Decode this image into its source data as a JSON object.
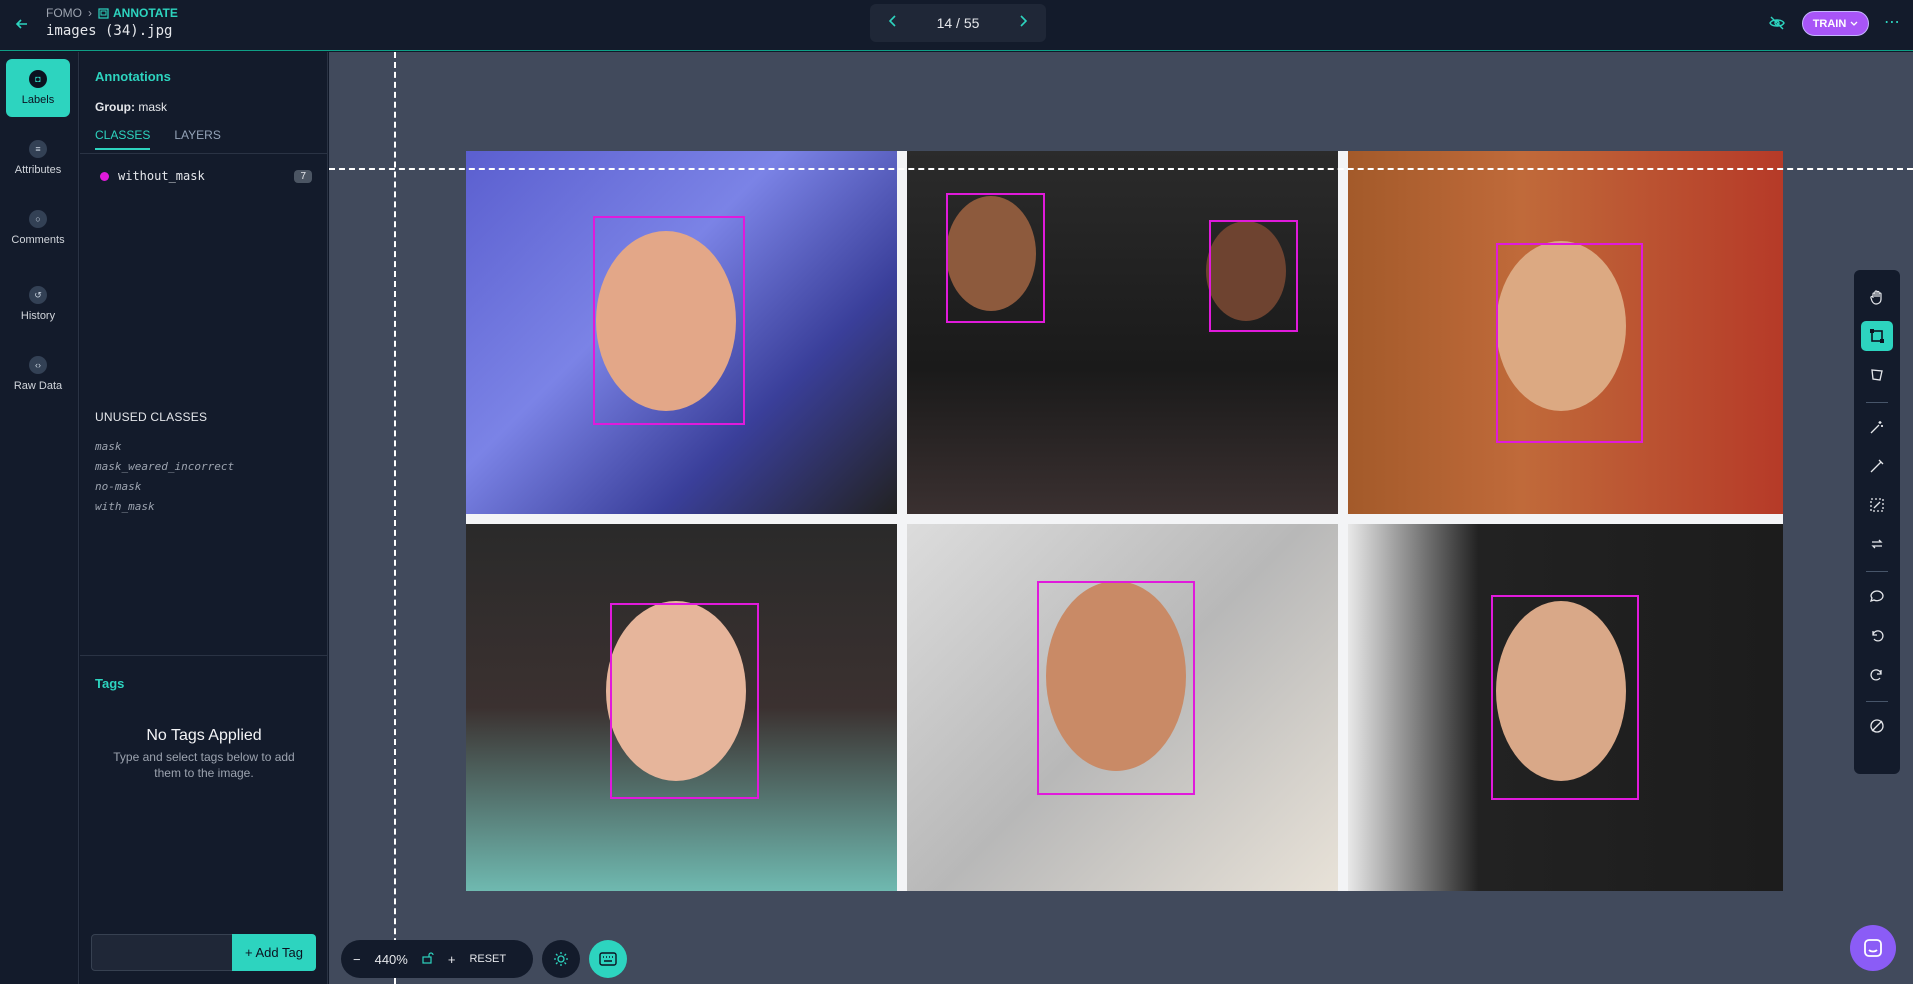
{
  "header": {
    "breadcrumb_root": "FOMO",
    "breadcrumb_current": "ANNOTATE",
    "filename": "images (34).jpg",
    "pager": "14 / 55",
    "train_label": "TRAIN"
  },
  "nav": {
    "items": [
      {
        "label": "Labels",
        "icon": "tag-icon"
      },
      {
        "label": "Attributes",
        "icon": "list-icon"
      },
      {
        "label": "Comments",
        "icon": "comment-icon"
      },
      {
        "label": "History",
        "icon": "history-icon"
      },
      {
        "label": "Raw Data",
        "icon": "code-icon"
      }
    ]
  },
  "panel": {
    "title": "Annotations",
    "group_label": "Group:",
    "group_value": "mask",
    "tabs": [
      "CLASSES",
      "LAYERS"
    ],
    "classes": [
      {
        "name": "without_mask",
        "count": "7",
        "color": "#e01adb"
      }
    ],
    "unused_title": "UNUSED CLASSES",
    "unused": [
      "mask",
      "mask_weared_incorrect",
      "no-mask",
      "with_mask"
    ],
    "tags_title": "Tags",
    "no_tags_title": "No Tags Applied",
    "no_tags_sub": "Type and select tags below to add them to the image.",
    "add_tag_label": "+ Add Tag"
  },
  "zoom": {
    "value": "440%",
    "reset_label": "RESET"
  },
  "colors": {
    "accent": "#2dd4bf",
    "bbox": "#e01adb",
    "train": "#a855f7"
  }
}
